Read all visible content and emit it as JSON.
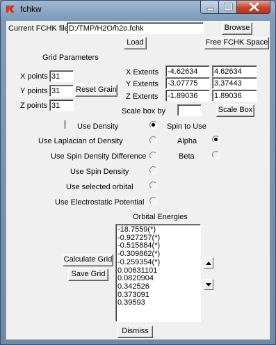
{
  "window": {
    "title": "fchkw",
    "app_icon": "tk-feather-icon"
  },
  "file": {
    "label": "Current FCHK file",
    "path": "D:/TMP/H2O/h2o.fchk",
    "browse_label": "Browse",
    "load_label": "Load",
    "free_label": "Free FCHK Space"
  },
  "grid": {
    "heading": "Grid Parameters",
    "x_points_label": "X points",
    "x_points": "31",
    "y_points_label": "Y points",
    "y_points": "31",
    "z_points_label": "Z points",
    "z_points": "31",
    "reset_label": "Reset Grain",
    "x_extents_label": "X Extents",
    "x_min": "-4.62634",
    "x_max": "4.62634",
    "y_extents_label": "Y Extents",
    "y_min": "-3.07775",
    "y_max": "3.37443",
    "z_extents_label": "Z Extents",
    "z_min": "-1.89036",
    "z_max": "1.89036",
    "scale_label": "Scale box by",
    "scale_value": "",
    "scale_button": "Scale Box"
  },
  "options": {
    "use_density": "Use Density",
    "use_laplacian": "Use Laplacian of Density",
    "use_spin_diff": "Use Spin Density Difference",
    "use_spin_density": "Use Spin Density",
    "use_orbital": "Use selected orbital",
    "use_esp": "Use Electrostatic Potential",
    "selected": "use_density"
  },
  "spin": {
    "heading": "Spin to Use",
    "alpha": "Alpha",
    "beta": "Beta",
    "selected": "alpha"
  },
  "orbitals": {
    "heading": "Orbital Energies",
    "items": [
      "-18.7559(*)",
      "-0.927257(*)",
      "-0.515884(*)",
      "-0.309862(*)",
      "-0.259354(*)",
      "0.00631101",
      "0.0820904",
      "0.342526",
      "0.373091",
      "0.39593"
    ],
    "calc_label": "Calculate Grid",
    "save_label": "Save Grid"
  },
  "dismiss_label": "Dismiss"
}
